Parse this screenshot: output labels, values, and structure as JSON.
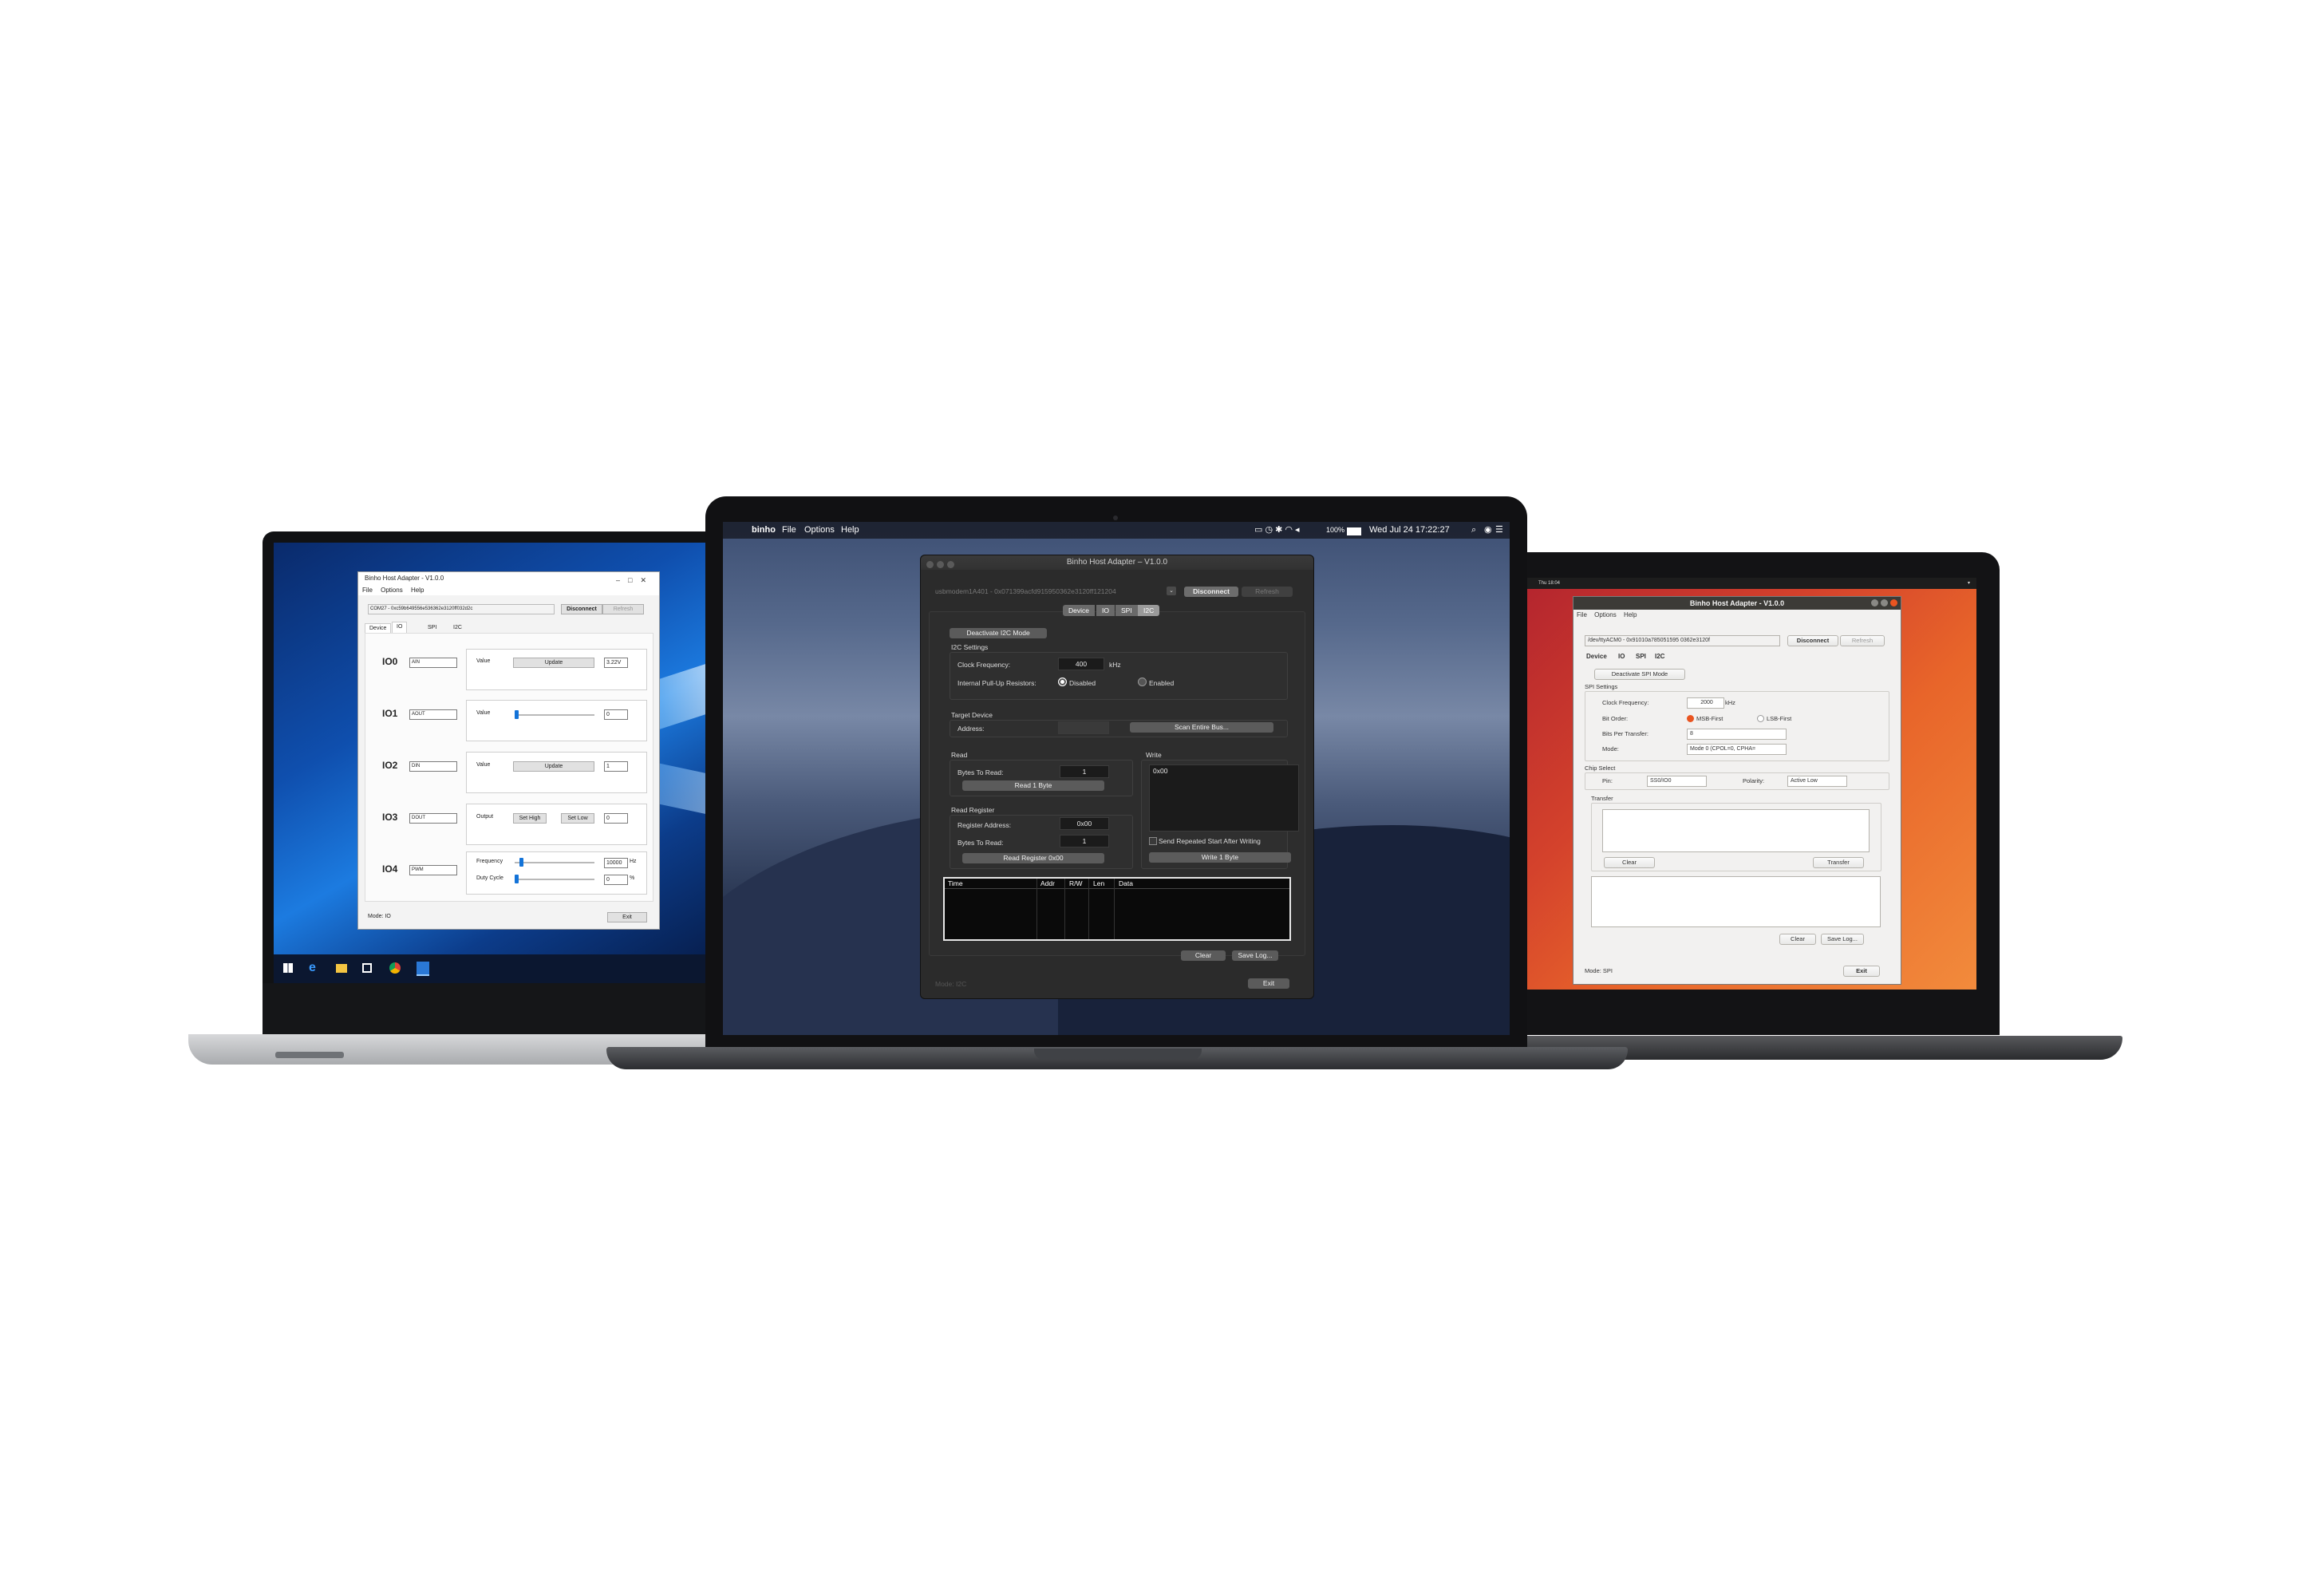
{
  "windows": {
    "title": "Binho Host Adapter - V1.0.0",
    "menu": [
      "File",
      "Options",
      "Help"
    ],
    "port": "COM27 - 0xc59b649556e536362e3120ff032d2c",
    "disconnect": "Disconnect",
    "refresh": "Refresh",
    "tabs": [
      "Device",
      "IO",
      "SPI",
      "I2C"
    ],
    "rows": [
      {
        "name": "IO0",
        "mode": "AIN",
        "label": "Value",
        "button": "Update",
        "value": "3.22V"
      },
      {
        "name": "IO1",
        "mode": "AOUT",
        "label": "Value",
        "value": "0"
      },
      {
        "name": "IO2",
        "mode": "DIN",
        "label": "Value",
        "button": "Update",
        "value": "1"
      },
      {
        "name": "IO3",
        "mode": "DOUT",
        "label": "Output",
        "button_high": "Set High",
        "button_low": "Set Low",
        "value": "0"
      },
      {
        "name": "IO4",
        "mode": "PWM",
        "label_freq": "Frequency",
        "freq": "10000",
        "freq_unit": "Hz",
        "label_duty": "Duty Cycle",
        "duty": "0",
        "duty_unit": "%"
      }
    ],
    "status": "Mode: IO",
    "exit": "Exit"
  },
  "mac": {
    "menubar": {
      "app": "binho",
      "items": [
        "File",
        "Options",
        "Help"
      ],
      "battery": "100%",
      "clock": "Wed Jul 24  17:22:27"
    },
    "title": "Binho Host Adapter – V1.0.0",
    "port": "usbmodem1A401 - 0x071399acfd915950362e3120ff121204",
    "disconnect": "Disconnect",
    "refresh": "Refresh",
    "tabs": [
      "Device",
      "IO",
      "SPI",
      "I2C"
    ],
    "deactivate": "Deactivate I2C Mode",
    "settings_header": "I2C Settings",
    "clock_label": "Clock Frequency:",
    "clock_value": "400",
    "clock_unit": "kHz",
    "pullup_label": "Internal Pull-Up Resistors:",
    "pullup_disabled": "Disabled",
    "pullup_enabled": "Enabled",
    "target_header": "Target Device",
    "address_label": "Address:",
    "scan": "Scan Entire Bus...",
    "read_header": "Read",
    "bytes_label": "Bytes To Read:",
    "bytes_value": "1",
    "read_button": "Read 1 Byte",
    "readreg_header": "Read Register",
    "regaddr_label": "Register Address:",
    "regaddr_value": "0x00",
    "regbytes_label": "Bytes To Read:",
    "regbytes_value": "1",
    "readreg_button": "Read Register 0x00",
    "write_header": "Write",
    "write_value": "0x00",
    "repeat_start": "Send Repeated Start After Writing",
    "write_button": "Write 1 Byte",
    "table_cols": [
      "Time",
      "Addr",
      "R/W",
      "Len",
      "Data"
    ],
    "clear": "Clear",
    "save_log": "Save Log...",
    "status": "Mode: I2C",
    "exit": "Exit"
  },
  "ubuntu": {
    "topbar_clock": "Thu 18:04",
    "title": "Binho Host Adapter - V1.0.0",
    "menu": [
      "File",
      "Options",
      "Help"
    ],
    "port": "/dev/ttyACM0 - 0x91010a785051595 0362e3120f",
    "disconnect": "Disconnect",
    "refresh": "Refresh",
    "tabs": [
      "Device",
      "IO",
      "SPI",
      "I2C"
    ],
    "deactivate": "Deactivate SPI Mode",
    "settings_header": "SPI Settings",
    "clock_label": "Clock Frequency:",
    "clock_value": "2000",
    "clock_unit": "kHz",
    "bitorder_label": "Bit Order:",
    "msb": "MSB-First",
    "lsb": "LSB-First",
    "bits_label": "Bits Per Transfer:",
    "bits_value": "8",
    "mode_label": "Mode:",
    "mode_value": "Mode 0 (CPOL=0, CPHA=",
    "cs_header": "Chip Select",
    "pin_label": "Pin:",
    "pin_value": "SS0/IO0",
    "polarity_label": "Polarity:",
    "polarity_value": "Active Low",
    "transfer_header": "Transfer",
    "clear": "Clear",
    "transfer": "Transfer",
    "clear2": "Clear",
    "save_log": "Save Log...",
    "status": "Mode: SPI",
    "exit": "Exit"
  }
}
